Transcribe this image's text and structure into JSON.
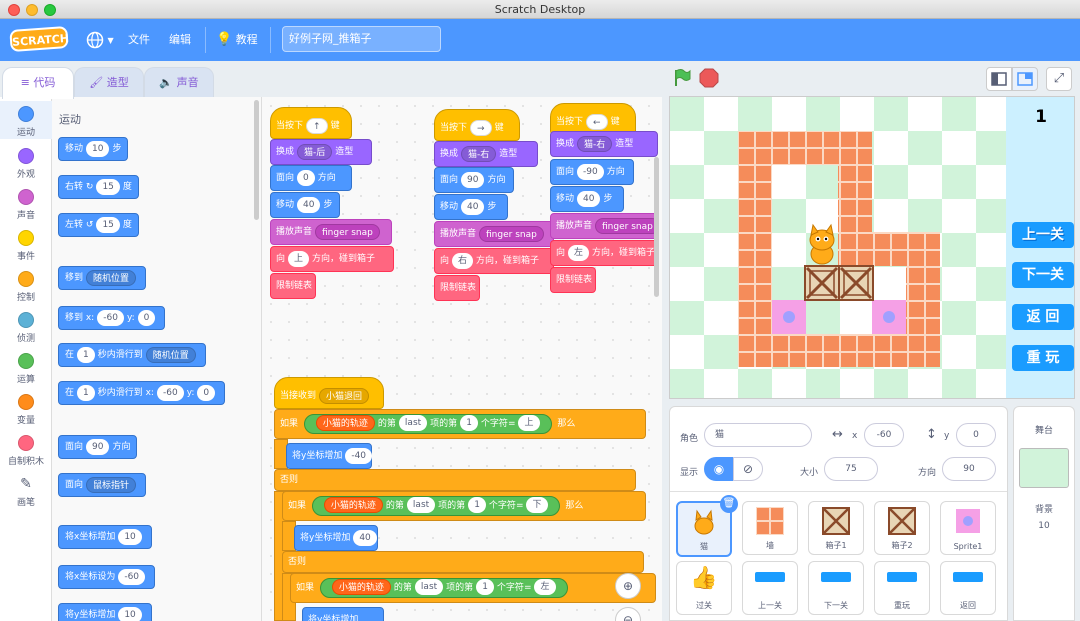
{
  "window": {
    "title": "Scratch Desktop"
  },
  "menu": {
    "logo": "SCRATCH",
    "file": "文件",
    "edit": "编辑",
    "tutorials": "教程",
    "project_title": "好例子网_推箱子"
  },
  "tabs": {
    "code": "代码",
    "costumes": "造型",
    "sounds": "声音"
  },
  "categories": [
    {
      "label": "运动",
      "color": "#4c97ff"
    },
    {
      "label": "外观",
      "color": "#9966ff"
    },
    {
      "label": "声音",
      "color": "#cf63cf"
    },
    {
      "label": "事件",
      "color": "#ffd500"
    },
    {
      "label": "控制",
      "color": "#ffab19"
    },
    {
      "label": "侦测",
      "color": "#5cb1d6"
    },
    {
      "label": "运算",
      "color": "#59c059"
    },
    {
      "label": "变量",
      "color": "#ff8c1a"
    },
    {
      "label": "自制积木",
      "color": "#ff6680"
    },
    {
      "label": "画笔",
      "color": "#0fbd8c"
    }
  ],
  "palette": {
    "heading": "运动",
    "move": {
      "a": "移动",
      "v": "10",
      "b": "步"
    },
    "turn_right": {
      "a": "右转",
      "v": "15",
      "b": "度"
    },
    "turn_left": {
      "a": "左转",
      "v": "15",
      "b": "度"
    },
    "goto": {
      "a": "移到",
      "dd": "随机位置"
    },
    "goto_xy": {
      "a": "移到 x:",
      "x": "-60",
      "b": "y:",
      "y": "0"
    },
    "glide": {
      "a": "在",
      "v": "1",
      "b": "秒内滑行到",
      "dd": "随机位置"
    },
    "glide_xy": {
      "a": "在",
      "v": "1",
      "b": "秒内滑行到 x:",
      "x": "-60",
      "c": "y:",
      "y": "0"
    },
    "point_dir": {
      "a": "面向",
      "v": "90",
      "b": "方向"
    },
    "point_towards": {
      "a": "面向",
      "dd": "鼠标指针"
    },
    "change_x": {
      "a": "将x坐标增加",
      "v": "10"
    },
    "set_x": {
      "a": "将x坐标设为",
      "v": "-60"
    },
    "change_y": {
      "a": "将y坐标增加",
      "v": "10"
    }
  },
  "scripts": {
    "s1": {
      "hat": "当按下",
      "key": "↑",
      "key_suffix": "键",
      "costume_a": "换成",
      "costume": "猫-后",
      "costume_b": "造型",
      "dir_a": "面向",
      "dir": "0",
      "dir_b": "方向",
      "move_a": "移动",
      "move": "40",
      "move_b": "步",
      "sound_a": "播放声音",
      "sound": "finger snap",
      "to_a": "向",
      "to": "上",
      "to_b": "方向，碰到箱子",
      "limit": "限制链表"
    },
    "s2": {
      "hat": "当按下",
      "key": "→",
      "key_suffix": "键",
      "costume_a": "换成",
      "costume": "猫-右",
      "costume_b": "造型",
      "dir_a": "面向",
      "dir": "90",
      "dir_b": "方向",
      "move_a": "移动",
      "move": "40",
      "move_b": "步",
      "sound_a": "播放声音",
      "sound": "finger snap",
      "to_a": "向",
      "to": "右",
      "to_b": "方向，碰到箱子",
      "limit": "限制链表"
    },
    "s3": {
      "hat": "当按下",
      "key": "←",
      "key_suffix": "键",
      "costume_a": "换成",
      "costume": "猫-右",
      "costume_b": "造型",
      "dir_a": "面向",
      "dir": "-90",
      "dir_b": "方向",
      "move_a": "移动",
      "move": "40",
      "move_b": "步",
      "sound_a": "播放声音",
      "sound": "finger snap",
      "to_a": "向",
      "to": "左",
      "to_b": "方向，碰到箱子",
      "limit": "限制链表"
    },
    "s4": {
      "hat": "当接收到",
      "msg": "小猫退回",
      "if1": "如果",
      "list": "小猫的轨迹",
      "of": "的第",
      "last": "last",
      "item": "项",
      "of2": "的第",
      "n": "1",
      "char": "个字符",
      "eq": "=",
      "v1": "上",
      "then": "那么",
      "change_y": "将y坐标增加",
      "y1": "-40",
      "else": "否则",
      "v2": "下",
      "y2": "40",
      "v3": "左"
    }
  },
  "stage": {
    "level": "1",
    "btn_prev": "上一关",
    "btn_next": "下一关",
    "btn_back": "返 回",
    "btn_replay": "重 玩"
  },
  "sprite_info": {
    "sprite_label": "角色",
    "sprite_name": "猫",
    "x_label": "x",
    "x": "-60",
    "y_label": "y",
    "y": "0",
    "show_label": "显示",
    "size_label": "大小",
    "size": "75",
    "dir_label": "方向",
    "direction": "90"
  },
  "sprites": [
    {
      "name": "猫"
    },
    {
      "name": "墙"
    },
    {
      "name": "箱子1"
    },
    {
      "name": "箱子2"
    },
    {
      "name": "Sprite1"
    },
    {
      "name": "过关"
    },
    {
      "name": "上一关"
    },
    {
      "name": "下一关"
    },
    {
      "name": "重玩"
    },
    {
      "name": "返回"
    }
  ],
  "stage_panel": {
    "title": "舞台",
    "bg_label": "背景",
    "bg_count": "10"
  },
  "colors": {
    "menu_blue": "#4c97ff",
    "wall": "#f58c5a",
    "grid_green": "#d0f5d8",
    "target": "#f5a0e6"
  }
}
